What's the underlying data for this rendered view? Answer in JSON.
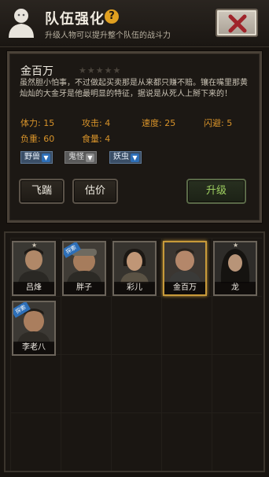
{
  "header": {
    "title": "队伍强化",
    "subtitle": "升级人物可以提升整个队伍的战斗力",
    "help_symbol": "?",
    "help_icon": "question-icon",
    "close_icon": "close-icon"
  },
  "character": {
    "name": "金百万",
    "stars": "★★★★★",
    "rating_filled": 0,
    "rating_max": 5,
    "description": "虽然胆小怕事，不过做起买卖那是从来都只赚不赔。镶在嘴里那黄灿灿的大金牙是他最明显的特征，据说是从死人上掰下来的！",
    "stats": [
      {
        "label": "体力:",
        "value": "15"
      },
      {
        "label": "攻击:",
        "value": "4"
      },
      {
        "label": "速度:",
        "value": "25"
      },
      {
        "label": "闪避:",
        "value": "5"
      },
      {
        "label": "负重:",
        "value": "60"
      },
      {
        "label": "食量:",
        "value": "4"
      }
    ],
    "tags": [
      {
        "label": "野兽",
        "style": "blue"
      },
      {
        "label": "鬼怪",
        "style": "grey"
      },
      {
        "label": "妖虫",
        "style": "blue"
      }
    ],
    "tag_arrow_icon": "down-arrow-icon"
  },
  "actions": {
    "kick": "飞踹",
    "appraise": "估价",
    "upgrade": "升级"
  },
  "roster": [
    {
      "name": "吕烽",
      "star": true,
      "badge": false,
      "selected": false
    },
    {
      "name": "胖子",
      "star": false,
      "badge": true,
      "selected": false
    },
    {
      "name": "彩儿",
      "star": false,
      "badge": false,
      "selected": false
    },
    {
      "name": "金百万",
      "star": false,
      "badge": false,
      "selected": true
    },
    {
      "name": "龙",
      "star": true,
      "badge": false,
      "selected": false
    },
    {
      "name": "李老八",
      "star": false,
      "badge": true,
      "selected": false
    }
  ],
  "roster_badge_text": "探索"
}
